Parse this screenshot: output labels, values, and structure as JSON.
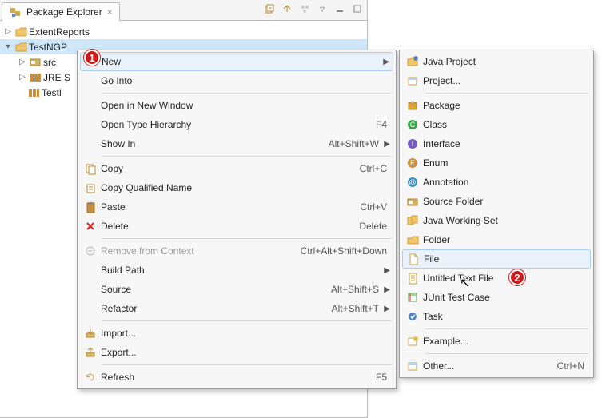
{
  "tab": {
    "title": "Package Explorer",
    "close": "×"
  },
  "tree": {
    "extent": "ExtentReports",
    "testng": "TestNGP",
    "src": "src",
    "jre": "JRE S",
    "testl": "Testl"
  },
  "markers": {
    "one": "1",
    "two": "2"
  },
  "ctx": {
    "new": "New",
    "go_into": "Go Into",
    "open_new_window": "Open in New Window",
    "open_type_hier": "Open Type Hierarchy",
    "open_type_hier_acc": "F4",
    "show_in": "Show In",
    "show_in_acc": "Alt+Shift+W",
    "copy": "Copy",
    "copy_acc": "Ctrl+C",
    "copy_qn": "Copy Qualified Name",
    "paste": "Paste",
    "paste_acc": "Ctrl+V",
    "delete": "Delete",
    "delete_acc": "Delete",
    "remove_ctx": "Remove from Context",
    "remove_ctx_acc": "Ctrl+Alt+Shift+Down",
    "build_path": "Build Path",
    "source": "Source",
    "source_acc": "Alt+Shift+S",
    "refactor": "Refactor",
    "refactor_acc": "Alt+Shift+T",
    "import": "Import...",
    "export": "Export...",
    "refresh": "Refresh",
    "refresh_acc": "F5"
  },
  "submenu": {
    "java_project": "Java Project",
    "project": "Project...",
    "package": "Package",
    "class": "Class",
    "interface": "Interface",
    "enum": "Enum",
    "annotation": "Annotation",
    "source_folder": "Source Folder",
    "jws": "Java Working Set",
    "folder": "Folder",
    "file": "File",
    "untitled": "Untitled Text File",
    "junit": "JUnit Test Case",
    "task": "Task",
    "example": "Example...",
    "other": "Other...",
    "other_acc": "Ctrl+N"
  }
}
